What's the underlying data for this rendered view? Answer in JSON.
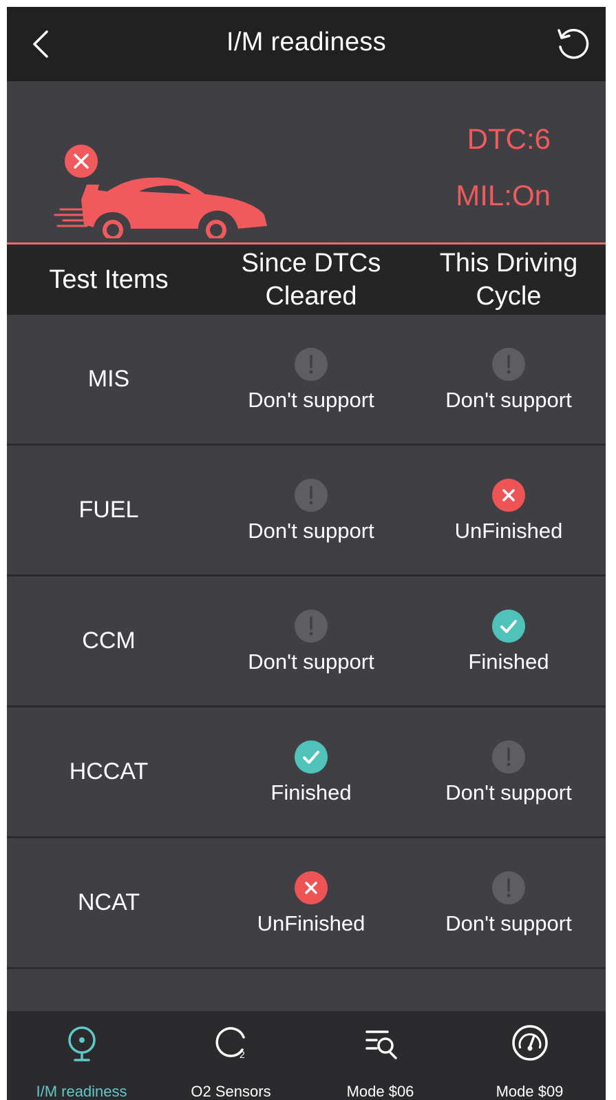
{
  "header": {
    "title": "I/M readiness",
    "back_icon": "chevron-left-icon",
    "refresh_icon": "refresh-icon"
  },
  "summary": {
    "dtc": "DTC:6",
    "mil": "MIL:On",
    "status_icon": "error-icon",
    "car_icon": "sports-car-icon",
    "accent_color": "#f05a5d"
  },
  "table": {
    "headers": [
      "Test Items",
      "Since DTCs Cleared",
      "This Driving Cycle"
    ],
    "header_lines": [
      [
        "Test Items"
      ],
      [
        "Since DTCs",
        "Cleared"
      ],
      [
        "This Driving",
        "Cycle"
      ]
    ],
    "rows": [
      {
        "item": "MIS",
        "since": {
          "status": "unsupported",
          "label": "Don't support"
        },
        "cycle": {
          "status": "unsupported",
          "label": "Don't support"
        }
      },
      {
        "item": "FUEL",
        "since": {
          "status": "unsupported",
          "label": "Don't support"
        },
        "cycle": {
          "status": "unfinished",
          "label": "UnFinished"
        }
      },
      {
        "item": "CCM",
        "since": {
          "status": "unsupported",
          "label": "Don't support"
        },
        "cycle": {
          "status": "finished",
          "label": "Finished"
        }
      },
      {
        "item": "HCCAT",
        "since": {
          "status": "finished",
          "label": "Finished"
        },
        "cycle": {
          "status": "unsupported",
          "label": "Don't support"
        }
      },
      {
        "item": "NCAT",
        "since": {
          "status": "unfinished",
          "label": "UnFinished"
        },
        "cycle": {
          "status": "unsupported",
          "label": "Don't support"
        }
      }
    ],
    "status_colors": {
      "finished": "#4fc3b9",
      "unfinished": "#ee5356",
      "unsupported": "#5d5d62"
    }
  },
  "tabs": [
    {
      "label": "I/M readiness",
      "icon": "readiness-icon",
      "active": true
    },
    {
      "label": "O2 Sensors",
      "icon": "o2-sensor-icon",
      "active": false
    },
    {
      "label": "Mode $06",
      "icon": "list-search-icon",
      "active": false
    },
    {
      "label": "Mode $09",
      "icon": "gauge-icon",
      "active": false
    }
  ]
}
